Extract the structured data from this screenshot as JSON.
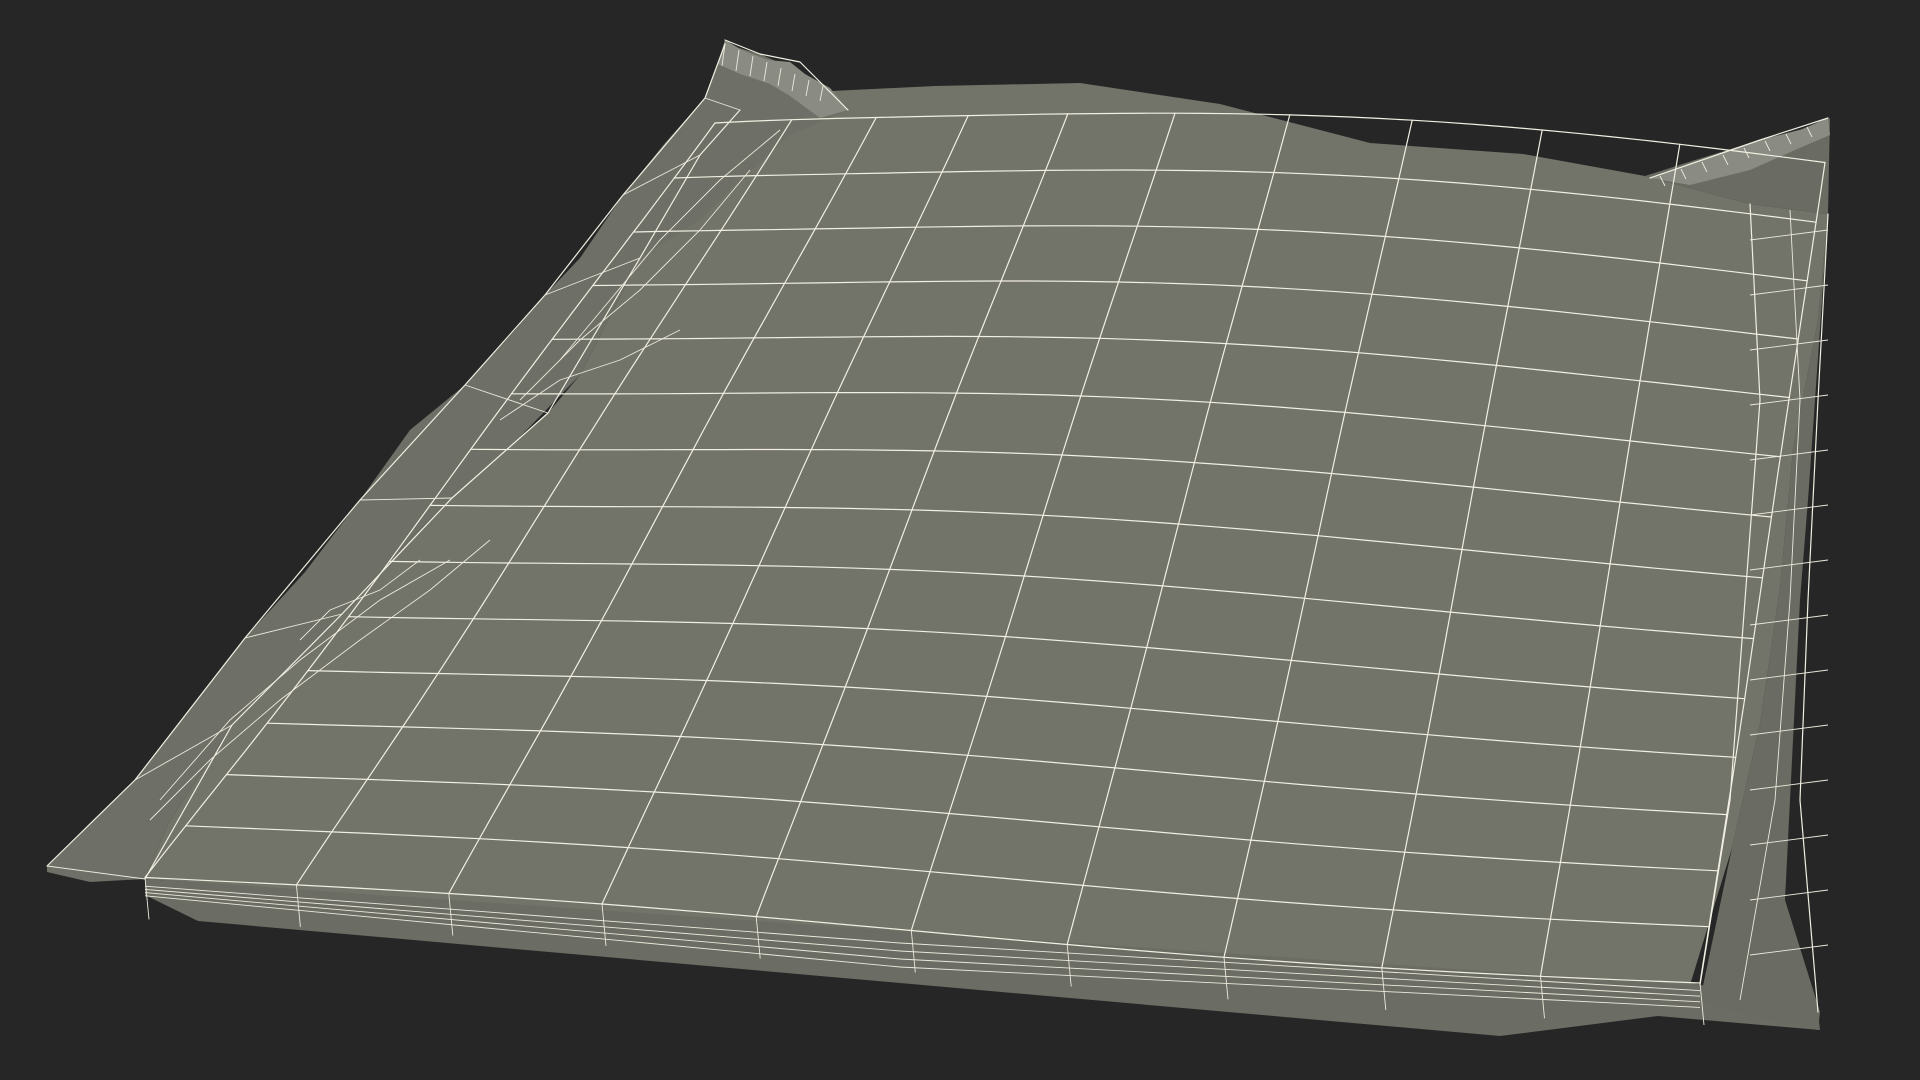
{
  "scene": {
    "subject": "sealed-pouch-wireframe",
    "colors": {
      "background": "#262626",
      "surface": "#727369",
      "surface_shadow": "#5f6058",
      "surface_side": "#686960",
      "wire": "#f1efe2"
    }
  }
}
